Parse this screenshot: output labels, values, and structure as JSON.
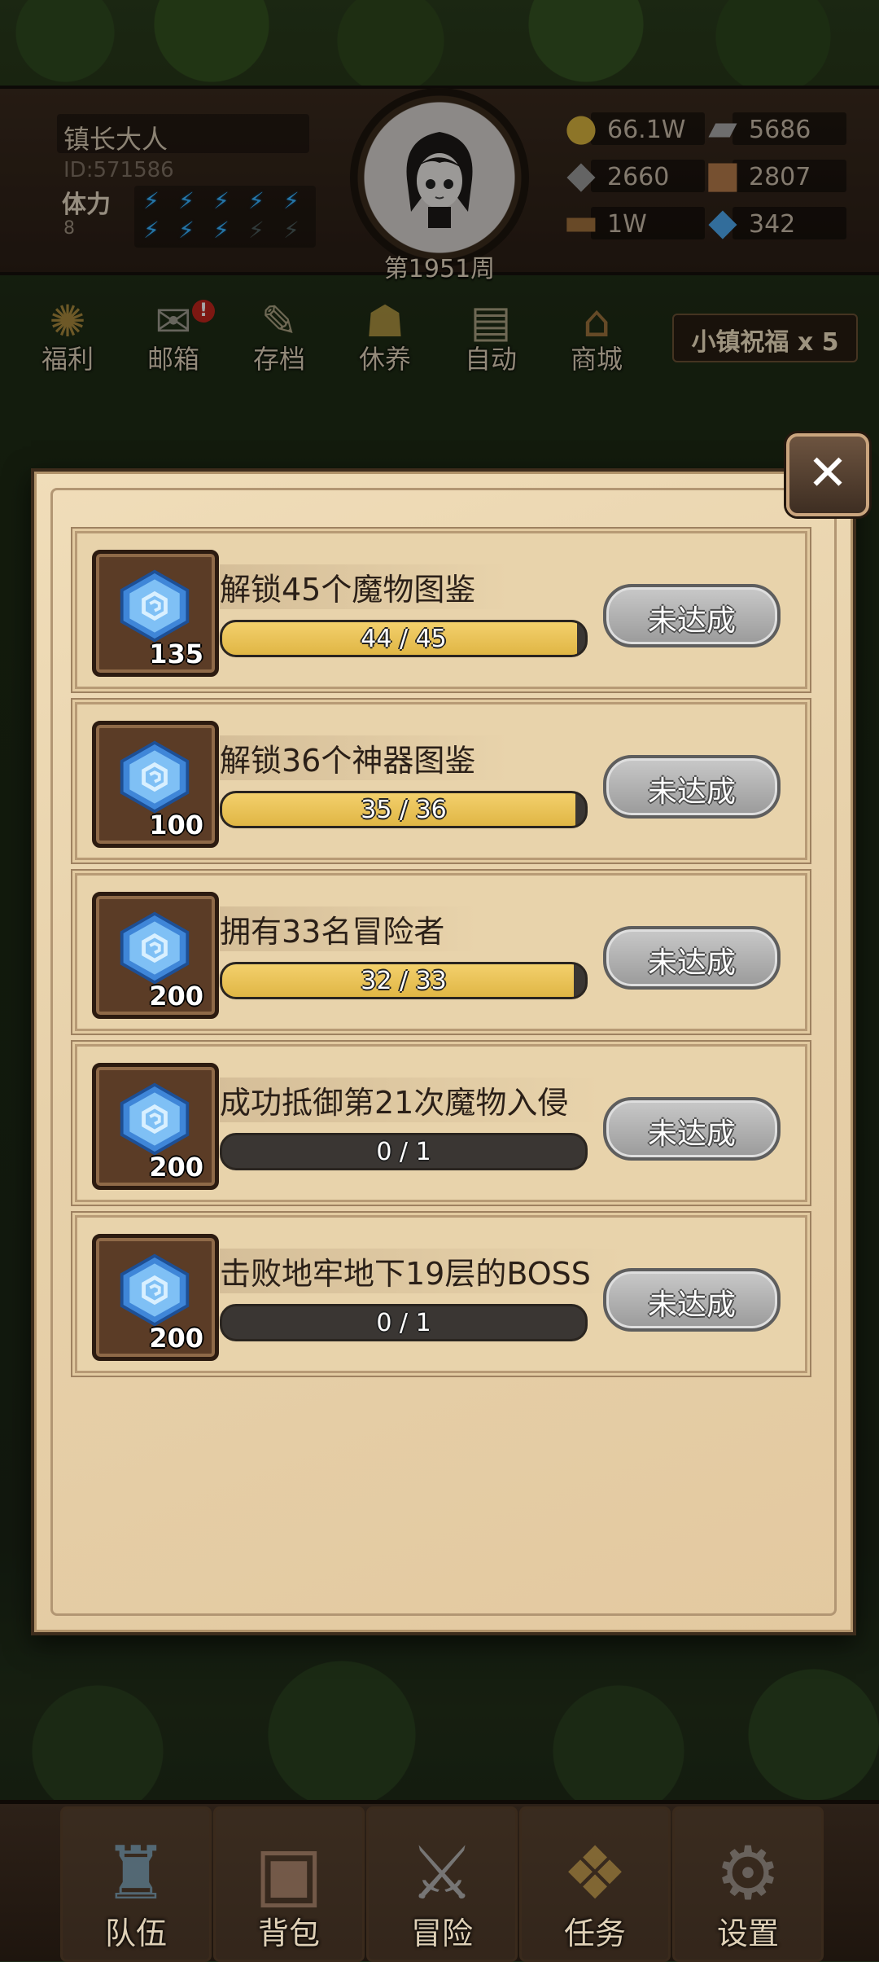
{
  "player": {
    "name": "镇长大人",
    "id": "ID:571586",
    "stamina_label": "体力",
    "stamina_value": "8",
    "stamina_filled": 8,
    "stamina_total": 10,
    "week": "第1951周"
  },
  "resources": [
    {
      "icon": "gold-coin-icon",
      "value": "66.1W"
    },
    {
      "icon": "iron-ingot-icon",
      "value": "5686"
    },
    {
      "icon": "stone-icon",
      "value": "2660"
    },
    {
      "icon": "leather-icon",
      "value": "2807"
    },
    {
      "icon": "wood-log-icon",
      "value": "1W"
    },
    {
      "icon": "blue-crystal-icon",
      "value": "342"
    }
  ],
  "menu": [
    {
      "label": "福利",
      "icon": "welfare-wheel-icon"
    },
    {
      "label": "邮箱",
      "icon": "mailbox-icon",
      "badge": "!"
    },
    {
      "label": "存档",
      "icon": "save-scroll-icon"
    },
    {
      "label": "休养",
      "icon": "rest-icon"
    },
    {
      "label": "自动",
      "icon": "auto-scroll-icon"
    },
    {
      "label": "商城",
      "icon": "shop-icon"
    }
  ],
  "blessing": "小镇祝福 x 5",
  "tasks": [
    {
      "reward": "135",
      "title": "解锁45个魔物图鉴",
      "progress": "44 / 45",
      "current": 44,
      "target": 45,
      "status": "未达成"
    },
    {
      "reward": "100",
      "title": "解锁36个神器图鉴",
      "progress": "35 / 36",
      "current": 35,
      "target": 36,
      "status": "未达成"
    },
    {
      "reward": "200",
      "title": "拥有33名冒险者",
      "progress": "32 / 33",
      "current": 32,
      "target": 33,
      "status": "未达成"
    },
    {
      "reward": "200",
      "title": "成功抵御第21次魔物入侵",
      "progress": "0 / 1",
      "current": 0,
      "target": 1,
      "status": "未达成"
    },
    {
      "reward": "200",
      "title": "击败地牢地下19层的BOSS",
      "progress": "0 / 1",
      "current": 0,
      "target": 1,
      "status": "未达成"
    }
  ],
  "bottom_nav": [
    {
      "label": "队伍",
      "icon": "helmet-icon"
    },
    {
      "label": "背包",
      "icon": "backpack-icon"
    },
    {
      "label": "冒险",
      "icon": "crossed-swords-icon"
    },
    {
      "label": "任务",
      "icon": "quest-icon"
    },
    {
      "label": "设置",
      "icon": "settings-gear-icon"
    }
  ]
}
